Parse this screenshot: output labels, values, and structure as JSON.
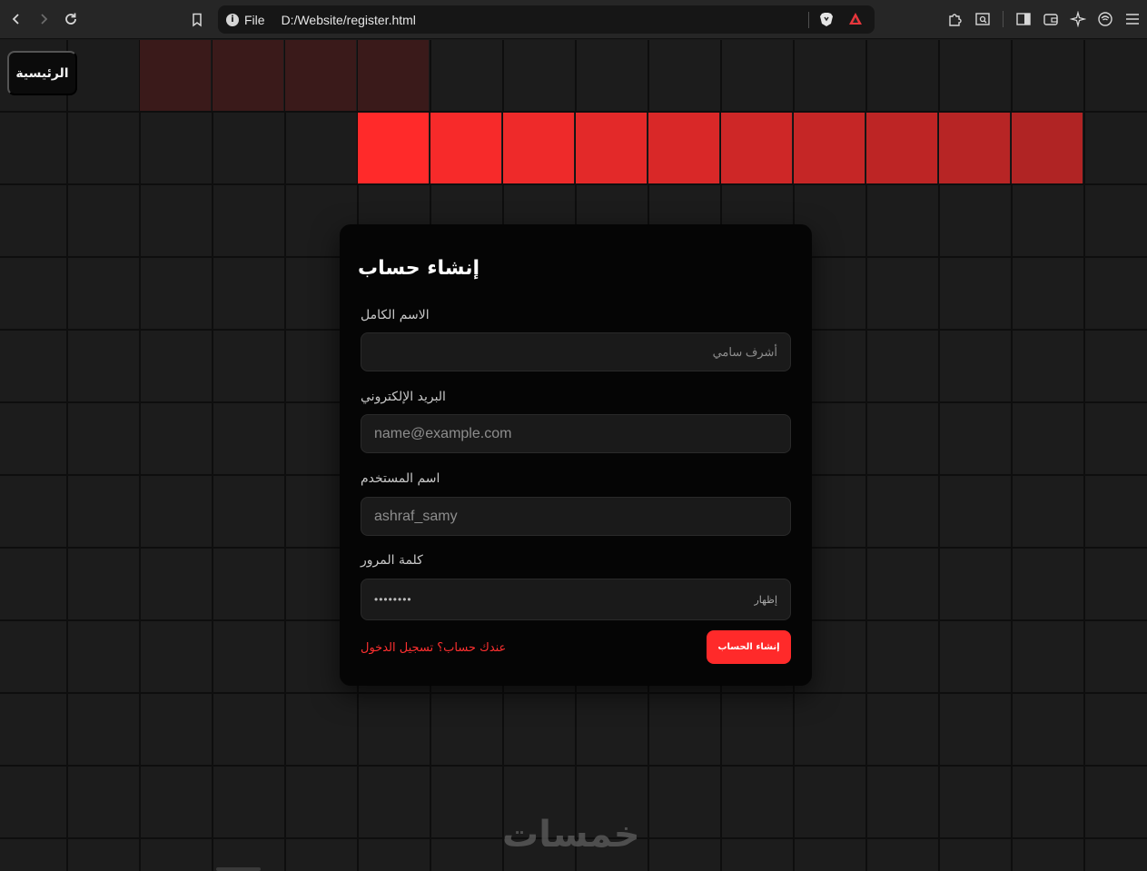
{
  "browser": {
    "scheme": "File",
    "url": "D:/Website/register.html"
  },
  "page": {
    "home_label": "الرئيسية",
    "highlight_colors": [
      "#3a1a1a",
      "#ff2a2a",
      "#f72a2a",
      "#ee2a2a",
      "#e32929",
      "#d92828",
      "#ce2727",
      "#c52626",
      "#bd2525",
      "#b72525",
      "#b02424"
    ],
    "watermark": "خمسات"
  },
  "form": {
    "title": "إنشاء حساب",
    "fields": [
      {
        "label": "الاسم الكامل",
        "value": "أشرف سامي"
      },
      {
        "label": "البريد الإلكتروني",
        "value": "name@example.com"
      },
      {
        "label": "اسم المستخدم",
        "value": "ashraf_samy"
      },
      {
        "label": "كلمة المرور",
        "value": "••••••••",
        "toggle": "إظهار"
      }
    ],
    "submit_label": "إنشاء الحساب",
    "login_link": "عندك حساب؟ تسجيل الدخول"
  }
}
